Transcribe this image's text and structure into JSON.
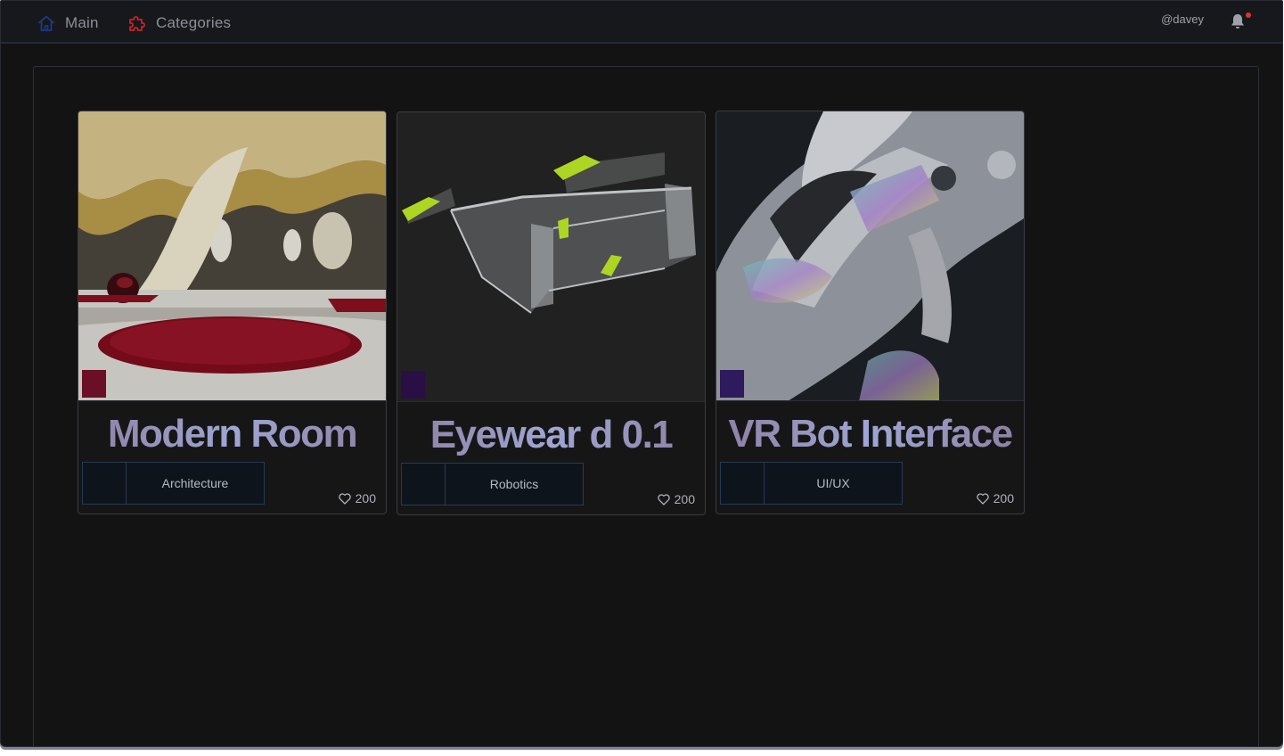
{
  "nav": {
    "main_label": "Main",
    "categories_label": "Categories",
    "main_icon": "home-icon",
    "categories_icon": "puzzle-icon"
  },
  "user": {
    "handle": "@davey",
    "notification_icon": "bell-icon",
    "has_unread": true
  },
  "colors": {
    "accent_home": "#1d3a8a",
    "accent_categories": "#c0262c",
    "notification_dot": "#e0322c",
    "tag_border": "#263a55"
  },
  "cards": [
    {
      "title": "Modern Room",
      "category": "Architecture",
      "likes": "200",
      "swatch_color": "#6a0f24",
      "like_icon": "heart-icon"
    },
    {
      "title": "Eyewear d 0.1",
      "category": "Robotics",
      "likes": "200",
      "swatch_color": "#2a0f45",
      "like_icon": "heart-icon"
    },
    {
      "title": "VR Bot Interface",
      "category": "UI/UX",
      "likes": "200",
      "swatch_color": "#2e1a5c",
      "like_icon": "heart-icon"
    }
  ]
}
